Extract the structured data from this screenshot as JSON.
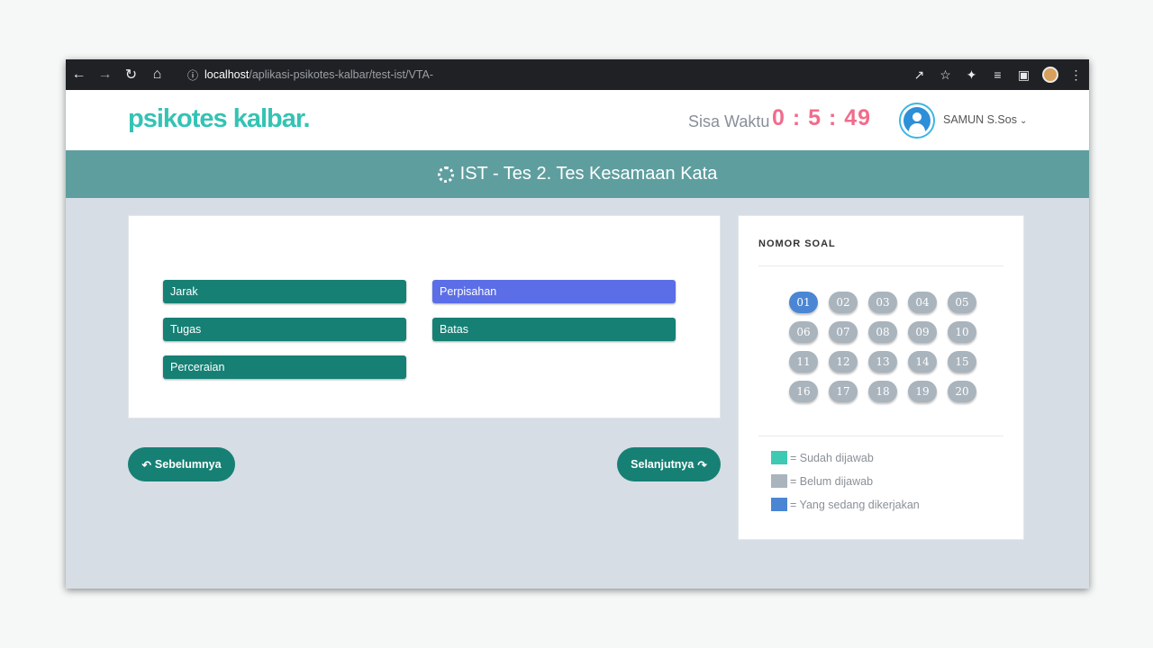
{
  "browser": {
    "url_host": "localhost",
    "url_path": "/aplikasi-psikotes-kalbar/test-ist/VTA-"
  },
  "header": {
    "logo": "psikotes kalbar.",
    "timer_label": "Sisa Waktu",
    "timer_value": "0 : 5 : 49",
    "username": "SAMUN S.Sos"
  },
  "title": "IST - Tes 2. Tes Kesamaan Kata",
  "options": [
    {
      "label": "Jarak",
      "selected": false
    },
    {
      "label": "Perpisahan",
      "selected": true
    },
    {
      "label": "Tugas",
      "selected": false
    },
    {
      "label": "Batas",
      "selected": false
    },
    {
      "label": "Perceraian",
      "selected": false
    }
  ],
  "nav": {
    "prev_label": "Sebelumnya",
    "next_label": "Selanjutnya"
  },
  "panel": {
    "title": "NOMOR SOAL",
    "numbers": [
      "01",
      "02",
      "03",
      "04",
      "05",
      "06",
      "07",
      "08",
      "09",
      "10",
      "11",
      "12",
      "13",
      "14",
      "15",
      "16",
      "17",
      "18",
      "19",
      "20"
    ],
    "current": "01",
    "legend": [
      {
        "label": "= Sudah dijawab",
        "color": "#3ec9b2"
      },
      {
        "label": "= Belum dijawab",
        "color": "#a9b4bd"
      },
      {
        "label": "= Yang sedang dikerjakan",
        "color": "#4a86d3"
      }
    ]
  },
  "colors": {
    "accent": "#168075",
    "selected_option": "#5b6ee7",
    "timer": "#f26c8c",
    "logo": "#34c3b4",
    "title_bar": "#5f9e9f"
  }
}
